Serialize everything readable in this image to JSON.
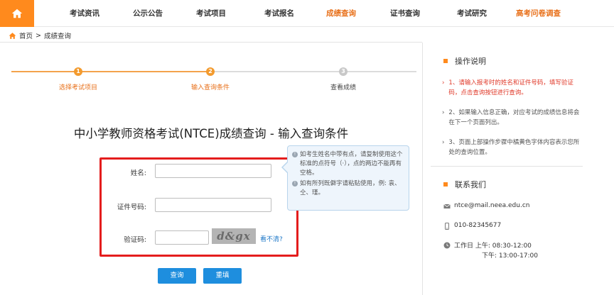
{
  "nav": {
    "items": [
      {
        "label": "考试资讯",
        "active": false
      },
      {
        "label": "公示公告",
        "active": false
      },
      {
        "label": "考试项目",
        "active": false
      },
      {
        "label": "考试报名",
        "active": false
      },
      {
        "label": "成绩查询",
        "active": true
      },
      {
        "label": "证书查询",
        "active": false
      },
      {
        "label": "考试研究",
        "active": false
      },
      {
        "label": "高考问卷调查",
        "active": true
      }
    ]
  },
  "breadcrumb": {
    "home": "首页",
    "sep": ">",
    "current": "成绩查询"
  },
  "steps": [
    {
      "num": "1",
      "label": "选择考试项目",
      "state": "done"
    },
    {
      "num": "2",
      "label": "输入查询条件",
      "state": "current"
    },
    {
      "num": "3",
      "label": "查看成绩",
      "state": "todo"
    }
  ],
  "title": "中小学教师资格考试(NTCE)成绩查询 - 输入查询条件",
  "form": {
    "name_label": "姓名:",
    "name_value": "",
    "id_label": "证件号码:",
    "id_value": "",
    "captcha_label": "验证码:",
    "captcha_value": "",
    "captcha_text": "d&gx",
    "captcha_refresh": "看不清?"
  },
  "tip": {
    "line1": "如考生姓名中带有点，请复制使用这个标准的点符号（·），点的两边不能再有空格。",
    "line2": "如有所列既僻字请粘贴使用，例: 袁、仝、瑾。"
  },
  "buttons": {
    "query": "查询",
    "reset": "重填"
  },
  "instructions": {
    "title": "操作说明",
    "items": [
      {
        "text": "1、请输入报考时的姓名和证件号码，填写验证码，点击查询按钮进行查询。",
        "highlight": true
      },
      {
        "text": "2、如果输入信息正确，对应考试的成绩信息将会在下一个页面列出。",
        "highlight": false
      },
      {
        "text": "3、页面上部操作步骤中橘黄色字体内容表示您所处的查询位置。",
        "highlight": false
      }
    ]
  },
  "contact": {
    "title": "联系我们",
    "email": "ntce@mail.neea.edu.cn",
    "phone": "010-82345677",
    "hours_label": "工作日",
    "am": "上午: 08:30-12:00",
    "pm": "下午: 13:00-17:00"
  },
  "colors": {
    "accent": "#ff8a1d",
    "active_text": "#e8701a",
    "button": "#1e8ede",
    "highlight_box": "#e41d1d",
    "link": "#1f78c8",
    "warn_text": "#e03a2a"
  }
}
